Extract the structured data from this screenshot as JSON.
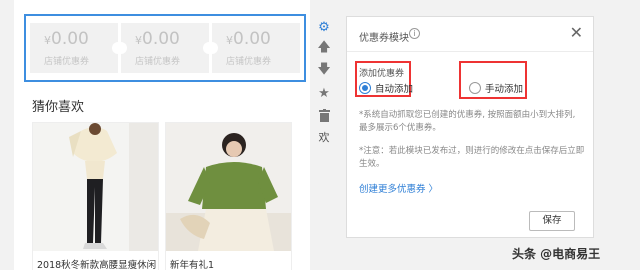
{
  "coupons": [
    {
      "currency": "¥",
      "amount": "0.00",
      "label": "店铺优惠券"
    },
    {
      "currency": "¥",
      "amount": "0.00",
      "label": "店铺优惠券"
    },
    {
      "currency": "¥",
      "amount": "0.00",
      "label": "店铺优惠券"
    }
  ],
  "guess": {
    "title": "猜你喜欢",
    "products": [
      {
        "name": "2018秋冬新款高腰显瘦休闲"
      },
      {
        "name": "新年有礼1"
      }
    ]
  },
  "toolbar": {
    "text_button": "欢"
  },
  "panel": {
    "title": "优惠券模块",
    "info_icon": "i",
    "close_icon": "✕",
    "add_label": "添加优惠券",
    "auto_label": "自动添加",
    "manual_label": "手动添加",
    "note1": "*系统自动抓取您已创建的优惠券, 按照面额由小到大排列, 最多展示6个优惠券。",
    "note2": "*注意：若此模块已发布过，则进行的修改在点击保存后立即生效。",
    "create_link": "创建更多优惠券 〉",
    "save_label": "保存",
    "selected_mode": "自动添加"
  },
  "watermark": "头条 @电商易王",
  "colors": {
    "accent": "#2f7fd6",
    "highlight": "#e33333"
  }
}
